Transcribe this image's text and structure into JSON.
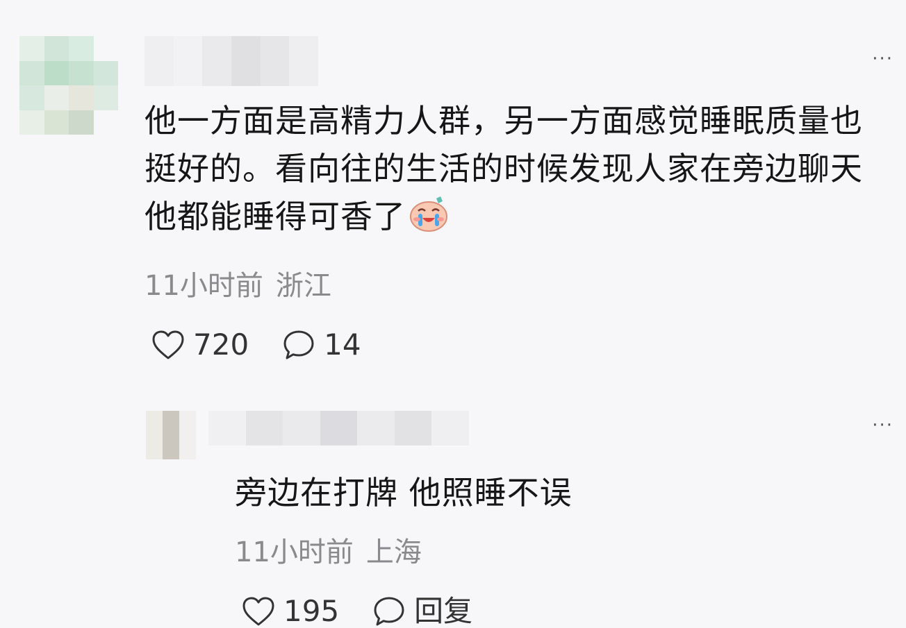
{
  "comments": [
    {
      "text": "他一方面是高精力人群，另一方面感觉睡眠质量也挺好的。看向往的生活的时候发现人家在旁边聊天他都能睡得可香了",
      "emoji": "crying-laughing-face-icon",
      "time": "11小时前",
      "location": "浙江",
      "likes": "720",
      "replies": "14",
      "more": "···"
    },
    {
      "text": "旁边在打牌 他照睡不误",
      "time": "11小时前",
      "location": "上海",
      "likes": "195",
      "reply_label": "回复",
      "more": "···"
    }
  ],
  "icons": {
    "like": "heart-outline-icon",
    "comment": "chat-bubble-icon",
    "more": "more-dots-icon"
  },
  "colors": {
    "background": "#f7f7f9",
    "text": "#161616",
    "meta": "#8a8a8e"
  }
}
